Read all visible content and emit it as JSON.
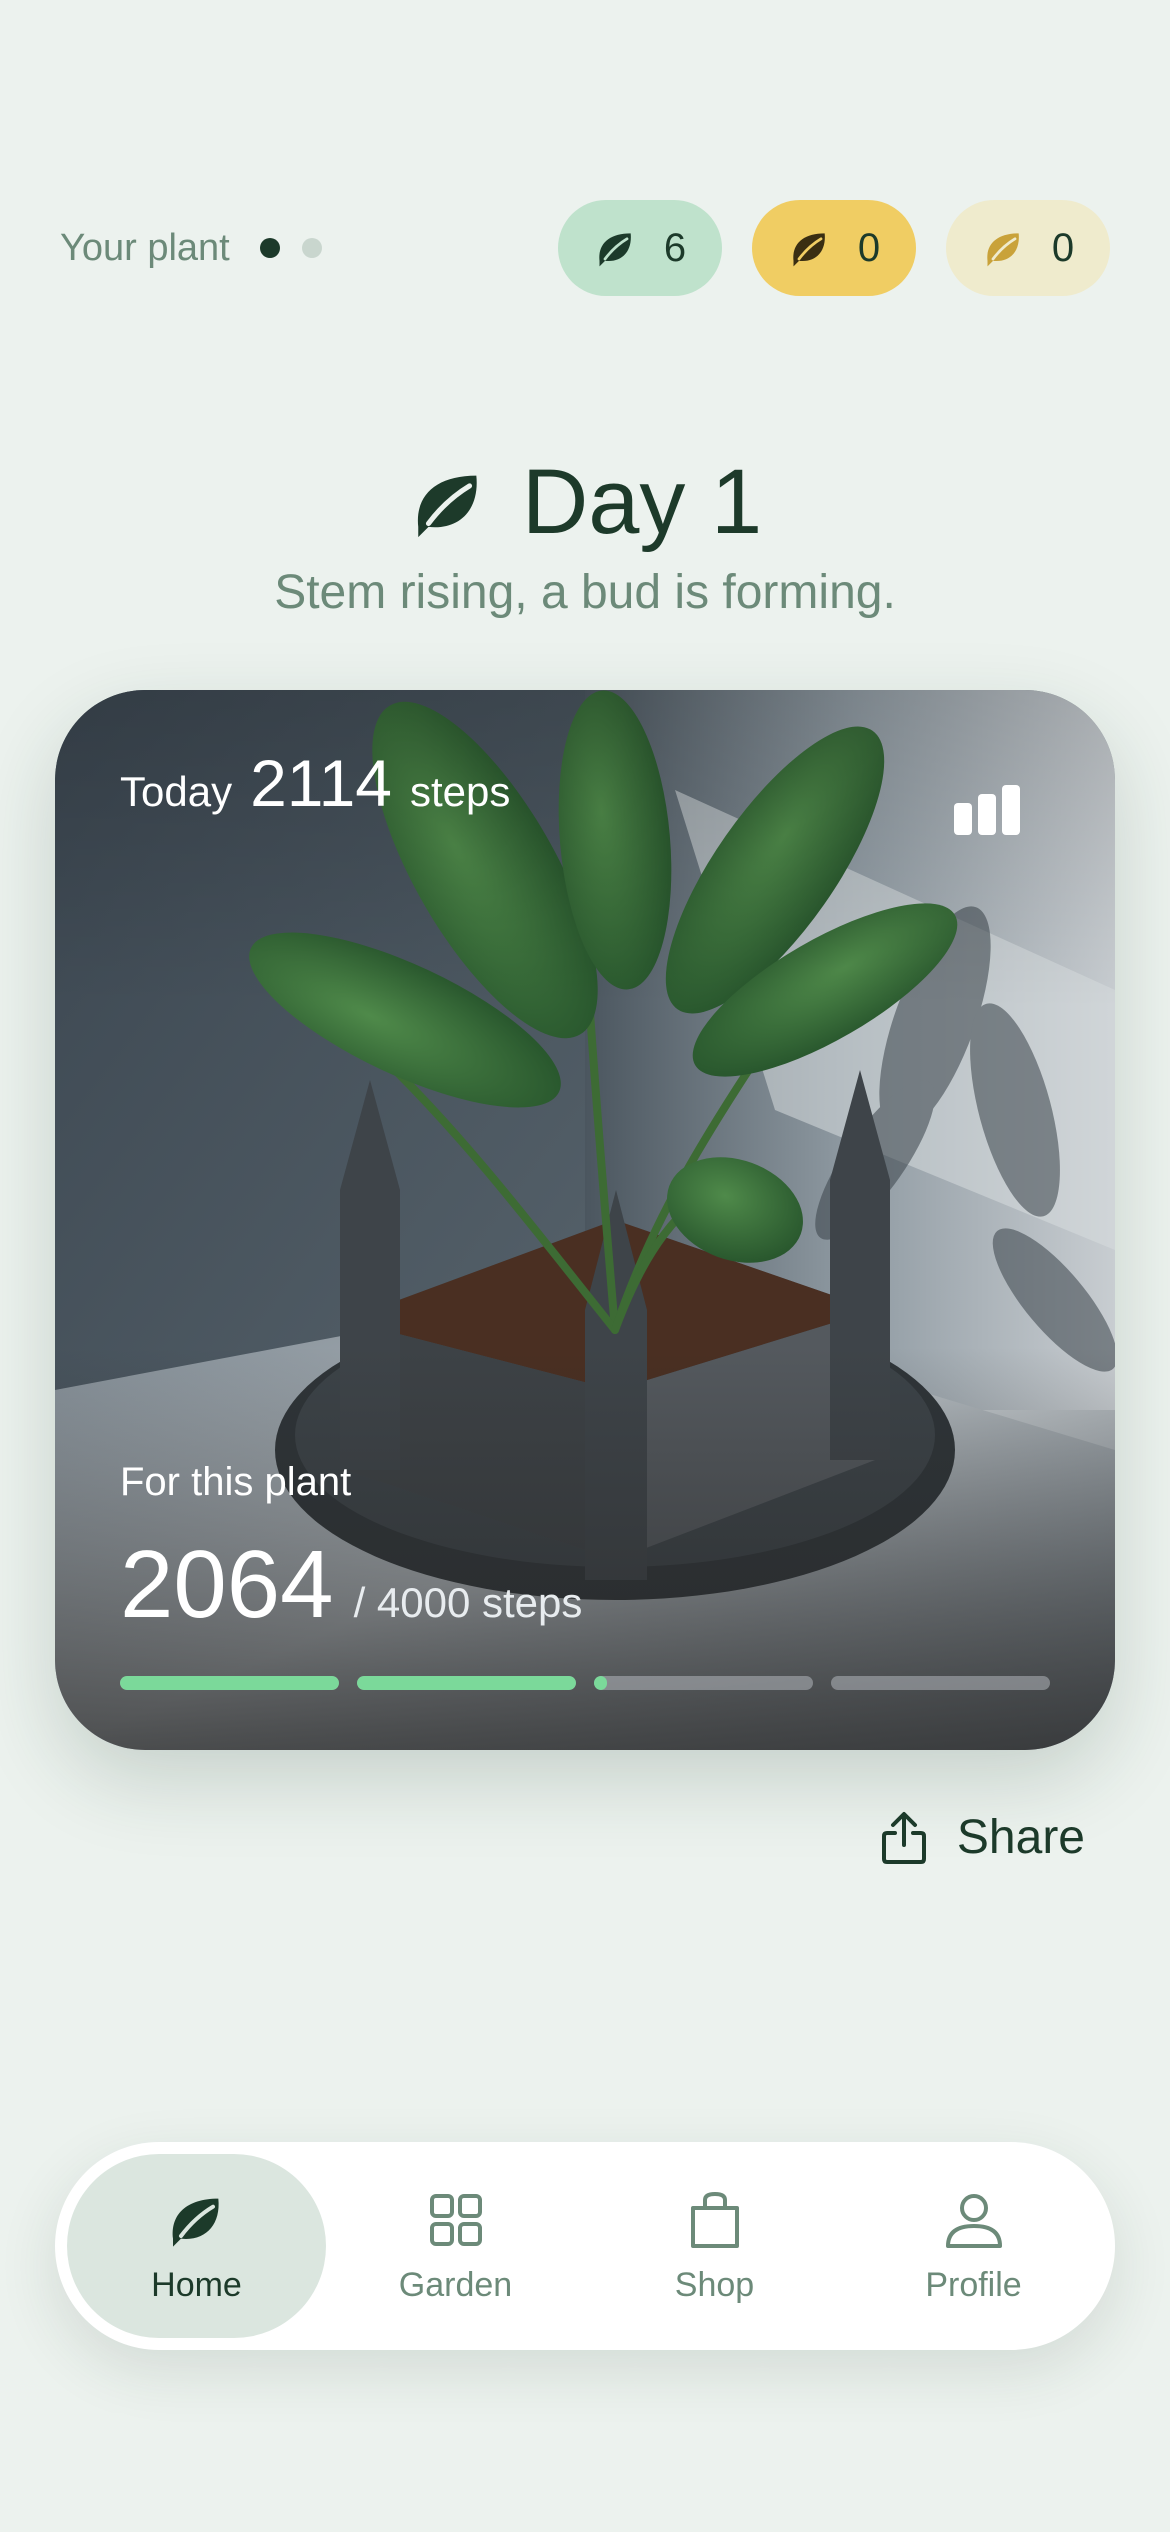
{
  "header": {
    "plant_label": "Your plant",
    "pager": {
      "count": 2,
      "active_index": 0
    },
    "badges": [
      {
        "name": "leaf-badge-green",
        "value": "6",
        "color": "#bfe2cc",
        "icon": "leaf-icon"
      },
      {
        "name": "leaf-badge-gold",
        "value": "0",
        "color": "#f0cd63",
        "icon": "leaf-icon"
      },
      {
        "name": "leaf-badge-cream",
        "value": "0",
        "color": "#efebcd",
        "icon": "leaf-icon"
      }
    ]
  },
  "day": {
    "title": "Day 1",
    "subtitle": "Stem rising, a bud is forming."
  },
  "card": {
    "today_label": "Today",
    "today_steps": "2114",
    "today_unit": "steps",
    "for_plant_label": "For this plant",
    "plant_steps": "2064",
    "goal_text": "/ 4000 steps",
    "progress": {
      "current": 2064,
      "goal": 4000
    },
    "segments": [
      1.0,
      1.0,
      0.06,
      0.0
    ],
    "stats_icon": "bar-chart-icon"
  },
  "share": {
    "label": "Share",
    "icon": "share-icon"
  },
  "nav": {
    "items": [
      {
        "label": "Home",
        "icon": "leaf-icon",
        "active": true
      },
      {
        "label": "Garden",
        "icon": "grid-icon",
        "active": false
      },
      {
        "label": "Shop",
        "icon": "bag-icon",
        "active": false
      },
      {
        "label": "Profile",
        "icon": "person-icon",
        "active": false
      }
    ]
  },
  "colors": {
    "background": "#ecf2ee",
    "primary": "#1c3a2a",
    "muted": "#6c8a79",
    "progress_fill": "#7bd99a"
  }
}
